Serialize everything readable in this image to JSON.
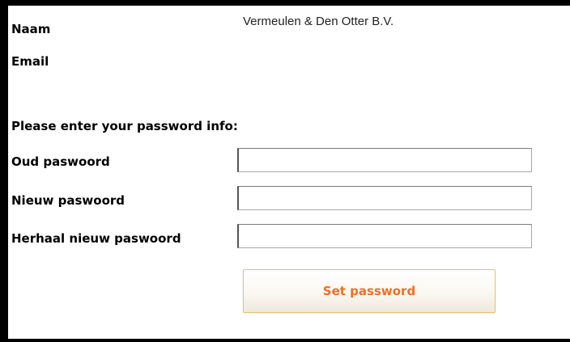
{
  "account": {
    "name_label": "Naam",
    "name_value": "Vermeulen & Den Otter B.V.",
    "email_label": "Email",
    "email_value": ""
  },
  "password_form": {
    "heading": "Please enter your password info:",
    "old_password_label": "Oud paswoord",
    "old_password_value": "",
    "new_password_label": "Nieuw paswoord",
    "new_password_value": "",
    "repeat_password_label": "Herhaal nieuw paswoord",
    "repeat_password_value": "",
    "submit_label": "Set password"
  },
  "colors": {
    "button_text": "#f26d21",
    "button_border": "#e2c27a",
    "frame_border": "#000000"
  }
}
